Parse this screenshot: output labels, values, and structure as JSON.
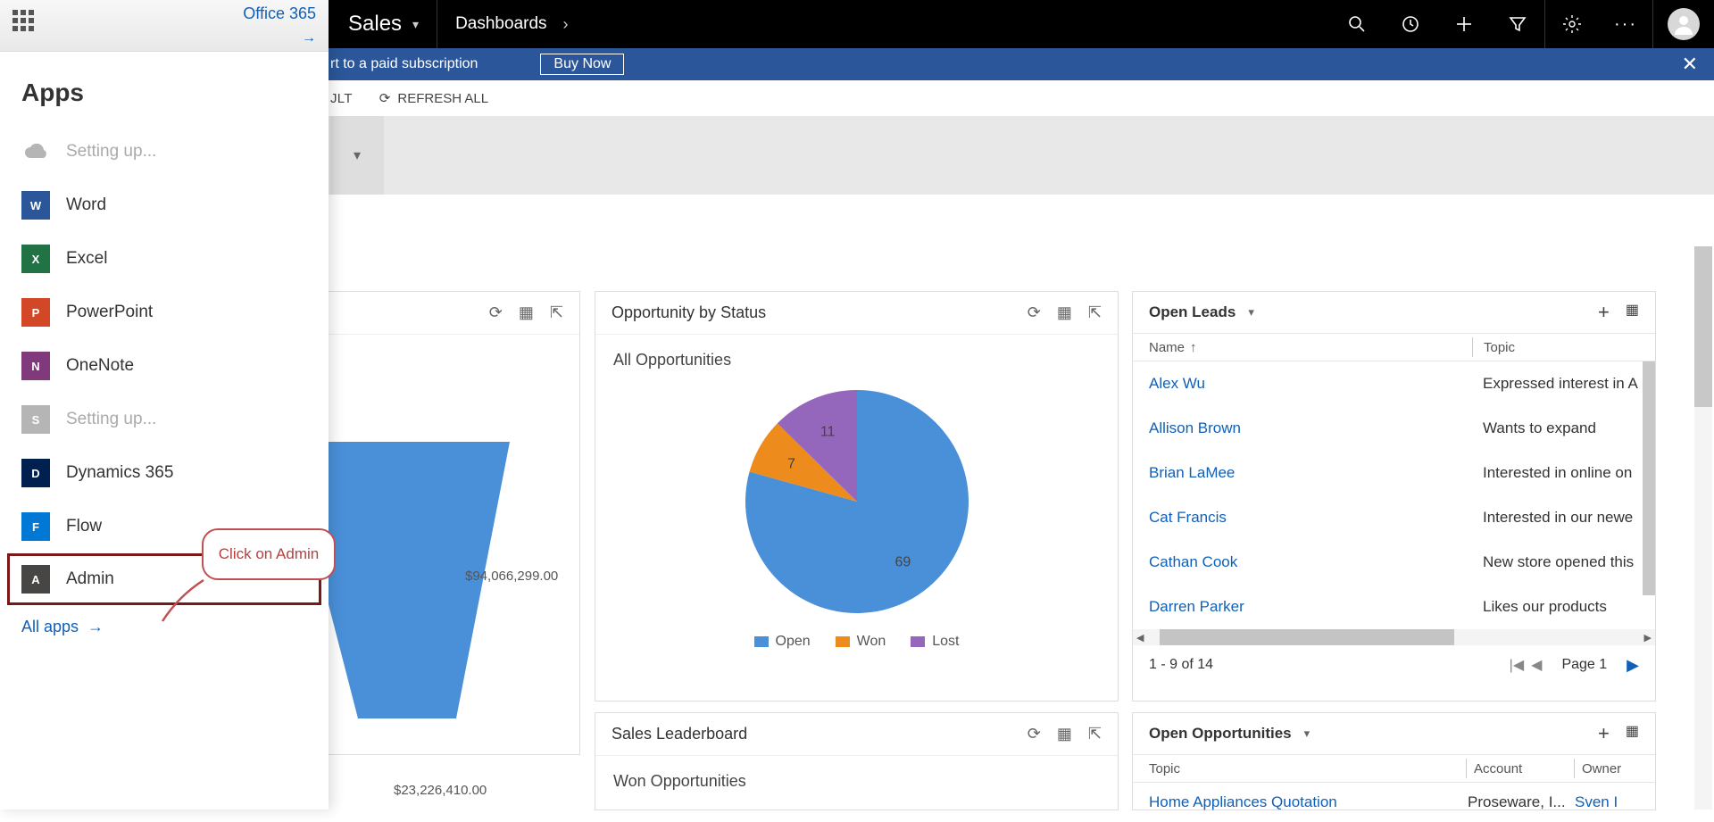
{
  "topbar": {
    "area": "Sales",
    "nav": "Dashboards"
  },
  "trial": {
    "message": "rt to a paid subscription",
    "buy": "Buy Now"
  },
  "cmdbar": {
    "item1": "JLT",
    "refresh": "REFRESH ALL"
  },
  "launcher": {
    "brand": "Office 365",
    "title": "Apps",
    "items": [
      {
        "label": "Setting up...",
        "color": "#b5b5b5",
        "icon": "cloud",
        "disabled": true
      },
      {
        "label": "Word",
        "color": "#2b579a",
        "icon": "W"
      },
      {
        "label": "Excel",
        "color": "#217346",
        "icon": "X"
      },
      {
        "label": "PowerPoint",
        "color": "#d24726",
        "icon": "P"
      },
      {
        "label": "OneNote",
        "color": "#80397b",
        "icon": "N"
      },
      {
        "label": "Setting up...",
        "color": "#b5b5b5",
        "icon": "S",
        "disabled": true
      },
      {
        "label": "Dynamics 365",
        "color": "#002050",
        "icon": "D"
      },
      {
        "label": "Flow",
        "color": "#0078d4",
        "icon": "F"
      },
      {
        "label": "Admin",
        "color": "#484644",
        "icon": "A",
        "highlight": true
      }
    ],
    "all_apps": "All apps"
  },
  "callout": {
    "text": "Click on Admin"
  },
  "funnel": {
    "v1": "$94,066,299.00",
    "v2": "$23,226,410.00"
  },
  "pie_widget": {
    "title": "Opportunity by Status",
    "subtitle": "All Opportunities"
  },
  "leaderboard": {
    "title": "Sales Leaderboard",
    "subtitle": "Won Opportunities"
  },
  "leads": {
    "title": "Open Leads",
    "col_name": "Name",
    "col_topic": "Topic",
    "rows": [
      {
        "name": "Alex Wu",
        "topic": "Expressed interest in A"
      },
      {
        "name": "Allison Brown",
        "topic": "Wants to expand"
      },
      {
        "name": "Brian LaMee",
        "topic": "Interested in online on"
      },
      {
        "name": "Cat Francis",
        "topic": "Interested in our newe"
      },
      {
        "name": "Cathan Cook",
        "topic": "New store opened this"
      },
      {
        "name": "Darren Parker",
        "topic": "Likes our products"
      }
    ],
    "pager_count": "1 - 9 of 14",
    "pager_page": "Page 1"
  },
  "opps": {
    "title": "Open Opportunities",
    "col_topic": "Topic",
    "col_account": "Account",
    "col_owner": "Owner",
    "rows": [
      {
        "topic": "Home Appliances Quotation",
        "account": "Proseware, I...",
        "owner": "Sven I"
      }
    ]
  },
  "chart_data": {
    "type": "pie",
    "title": "Opportunity by Status — All Opportunities",
    "series": [
      {
        "name": "Open",
        "value": 69,
        "color": "#4a90d9"
      },
      {
        "name": "Won",
        "value": 7,
        "color": "#ed8b1c"
      },
      {
        "name": "Lost",
        "value": 11,
        "color": "#9467bd"
      }
    ],
    "legend": [
      "Open",
      "Won",
      "Lost"
    ]
  }
}
